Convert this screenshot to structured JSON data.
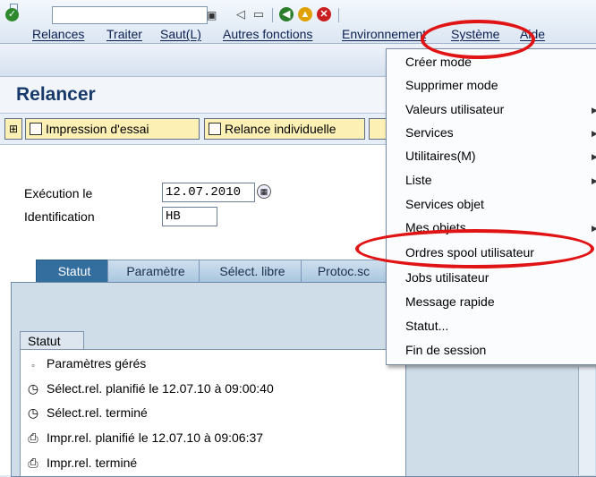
{
  "menubar": {
    "items": [
      "Relances",
      "Traiter",
      "Saut(L)",
      "Autres fonctions",
      "Environnement",
      "Système",
      "Aide"
    ]
  },
  "title": "Relancer",
  "app_toolbar": {
    "print_test": "Impression d'essai",
    "individual_reminder": "Relance individuelle"
  },
  "form": {
    "execution_label": "Exécution le",
    "execution_value": "12.07.2010",
    "identification_label": "Identification",
    "identification_value": "HB"
  },
  "tabs": [
    "Statut",
    "Paramètre",
    "Sélect. libre",
    "Protoc.sc"
  ],
  "status_group": {
    "title": "Statut",
    "rows": [
      {
        "icon": "square-bullet-icon",
        "text": "Paramètres gérés"
      },
      {
        "icon": "clock-icon",
        "text": "Sélect.rel. planifié le 12.07.10   à 09:00:40"
      },
      {
        "icon": "clock-icon",
        "text": "Sélect.rel. terminé"
      },
      {
        "icon": "printer-icon",
        "text": "Impr.rel. planifié le 12.07.10   à 09:06:37"
      },
      {
        "icon": "printer-icon",
        "text": "Impr.rel. terminé"
      }
    ]
  },
  "dropdown": {
    "items": [
      {
        "label": "Créer mode",
        "submenu": false
      },
      {
        "label": "Supprimer mode",
        "submenu": false
      },
      {
        "label": "Valeurs utilisateur",
        "submenu": true
      },
      {
        "label": "Services",
        "submenu": true
      },
      {
        "label": "Utilitaires(M)",
        "submenu": true
      },
      {
        "label": "Liste",
        "submenu": true
      },
      {
        "label": "Services objet",
        "submenu": false
      },
      {
        "label": "Mes objets",
        "submenu": true
      },
      {
        "label": "Ordres spool utilisateur",
        "submenu": false
      },
      {
        "label": "Jobs utilisateur",
        "submenu": false
      },
      {
        "label": "Message rapide",
        "submenu": false
      },
      {
        "label": "Statut...",
        "submenu": false
      },
      {
        "label": "Fin de session",
        "submenu": false
      }
    ]
  },
  "colors": {
    "annotation": "#e01414",
    "title": "#173a6a",
    "active_tab": "#336e9f"
  }
}
